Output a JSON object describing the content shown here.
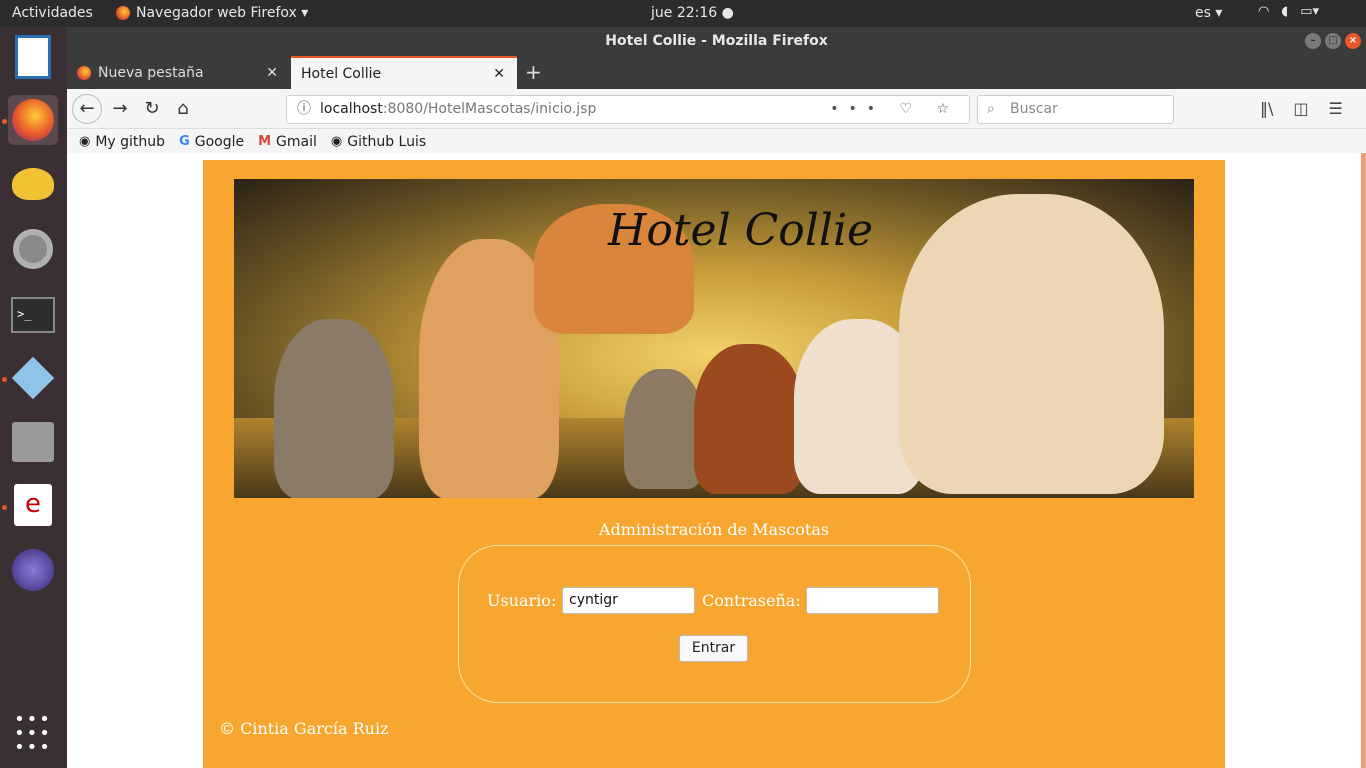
{
  "topbar": {
    "activities": "Actividades",
    "app_menu": "Navegador web Firefox ▾",
    "clock": "jue 22:16 ●",
    "lang": "es ▾",
    "tray": "⚡ 🔊 ▾"
  },
  "window": {
    "title": "Hotel Collie - Mozilla Firefox",
    "tabs": [
      {
        "label": "Nueva pestaña"
      },
      {
        "label": "Hotel Collie"
      }
    ],
    "new_tab": "+",
    "url_host": "localhost",
    "url_rest": ":8080/HotelMascotas/inicio.jsp",
    "url_actions": "••• ♡ ☆",
    "search_placeholder": "Buscar",
    "bookmarks": [
      {
        "label": "My github",
        "icon": "github-icon"
      },
      {
        "label": "Google",
        "icon": "google-icon"
      },
      {
        "label": "Gmail",
        "icon": "gmail-icon"
      },
      {
        "label": "Github Luis",
        "icon": "github-icon"
      }
    ]
  },
  "page": {
    "banner_title": "Hotel Collie",
    "admin_title": "Administración de Mascotas",
    "user_label": "Usuario:",
    "user_value": "cyntigr",
    "password_label": "Contraseña:",
    "password_value": "",
    "submit_label": "Entrar",
    "footer": "© Cintia García Ruiz"
  },
  "colors": {
    "page_bg": "#f7a730",
    "accent": "#e8572a",
    "dock_bg": "#3a2f33"
  }
}
